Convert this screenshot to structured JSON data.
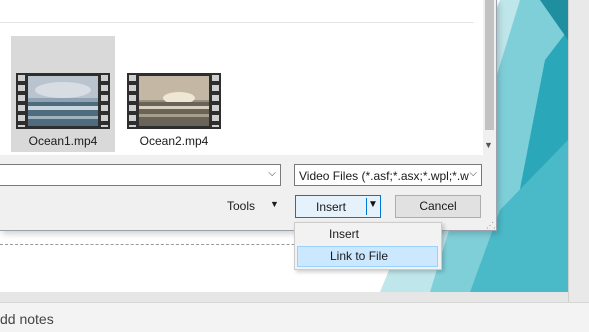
{
  "dialog": {
    "files": [
      {
        "name": "Ocean1.mp4",
        "selected": true
      },
      {
        "name": "Ocean2.mp4",
        "selected": false
      }
    ],
    "filename_value": "",
    "file_type_filter": "Video Files (*.asf;*.asx;*.wpl;*.w",
    "tools_label": "Tools",
    "insert_label": "Insert",
    "cancel_label": "Cancel",
    "insert_menu": [
      {
        "label": "Insert",
        "highlighted": false
      },
      {
        "label": "Link to File",
        "highlighted": true
      }
    ]
  },
  "notes": {
    "placeholder": "dd notes"
  },
  "colors": {
    "accent": "#0078d7",
    "menu_highlight": "#cce8ff",
    "slide_teal": "#2aa7b8"
  }
}
